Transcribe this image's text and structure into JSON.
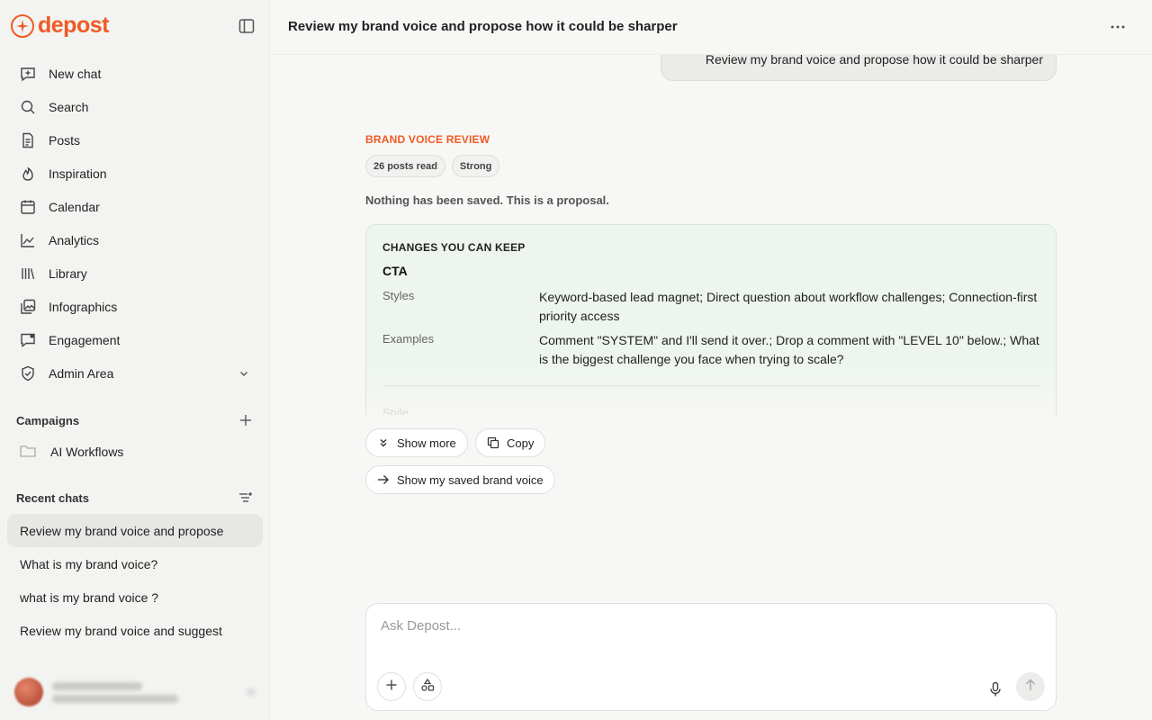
{
  "brand": {
    "name": "depost",
    "accent": "#f05a24"
  },
  "sidebar": {
    "nav": [
      {
        "label": "New chat",
        "icon": "new-chat-icon"
      },
      {
        "label": "Search",
        "icon": "search-icon"
      },
      {
        "label": "Posts",
        "icon": "document-icon"
      },
      {
        "label": "Inspiration",
        "icon": "flame-icon"
      },
      {
        "label": "Calendar",
        "icon": "calendar-icon"
      },
      {
        "label": "Analytics",
        "icon": "chart-line-icon"
      },
      {
        "label": "Library",
        "icon": "library-icon"
      },
      {
        "label": "Infographics",
        "icon": "image-gallery-icon"
      },
      {
        "label": "Engagement",
        "icon": "chat-bubble-icon"
      },
      {
        "label": "Admin Area",
        "icon": "shield-check-icon"
      }
    ],
    "campaigns": {
      "title": "Campaigns",
      "items": [
        {
          "label": "AI Workflows",
          "icon": "folder-icon"
        }
      ]
    },
    "recent": {
      "title": "Recent chats",
      "items": [
        {
          "label": "Review my brand voice and propose",
          "active": true
        },
        {
          "label": "What is my brand voice?",
          "active": false
        },
        {
          "label": "what is my brand voice ?",
          "active": false
        },
        {
          "label": "Review my brand voice and suggest",
          "active": false
        }
      ]
    }
  },
  "chat": {
    "title": "Review my brand voice and propose how it could be sharper",
    "user_message": "Review my brand voice and propose how it could be sharper",
    "review": {
      "label": "BRAND VOICE REVIEW",
      "badges": [
        "26 posts read",
        "Strong"
      ],
      "notice": "Nothing has been saved. This is a proposal.",
      "card": {
        "heading": "CHANGES YOU CAN KEEP",
        "subheading": "CTA",
        "rows": [
          {
            "key": "Styles",
            "value": "Keyword-based lead magnet; Direct question about workflow challenges; Connection-first priority access"
          },
          {
            "key": "Examples",
            "value": "Comment \"SYSTEM\" and I'll send it over.; Drop a comment with \"LEVEL 10\" below.; What is the biggest challenge you face when trying to scale?"
          }
        ],
        "faded": "Style"
      },
      "actions": {
        "show_more": "Show more",
        "copy": "Copy",
        "show_saved": "Show my saved brand voice"
      }
    }
  },
  "composer": {
    "placeholder": "Ask Depost..."
  }
}
